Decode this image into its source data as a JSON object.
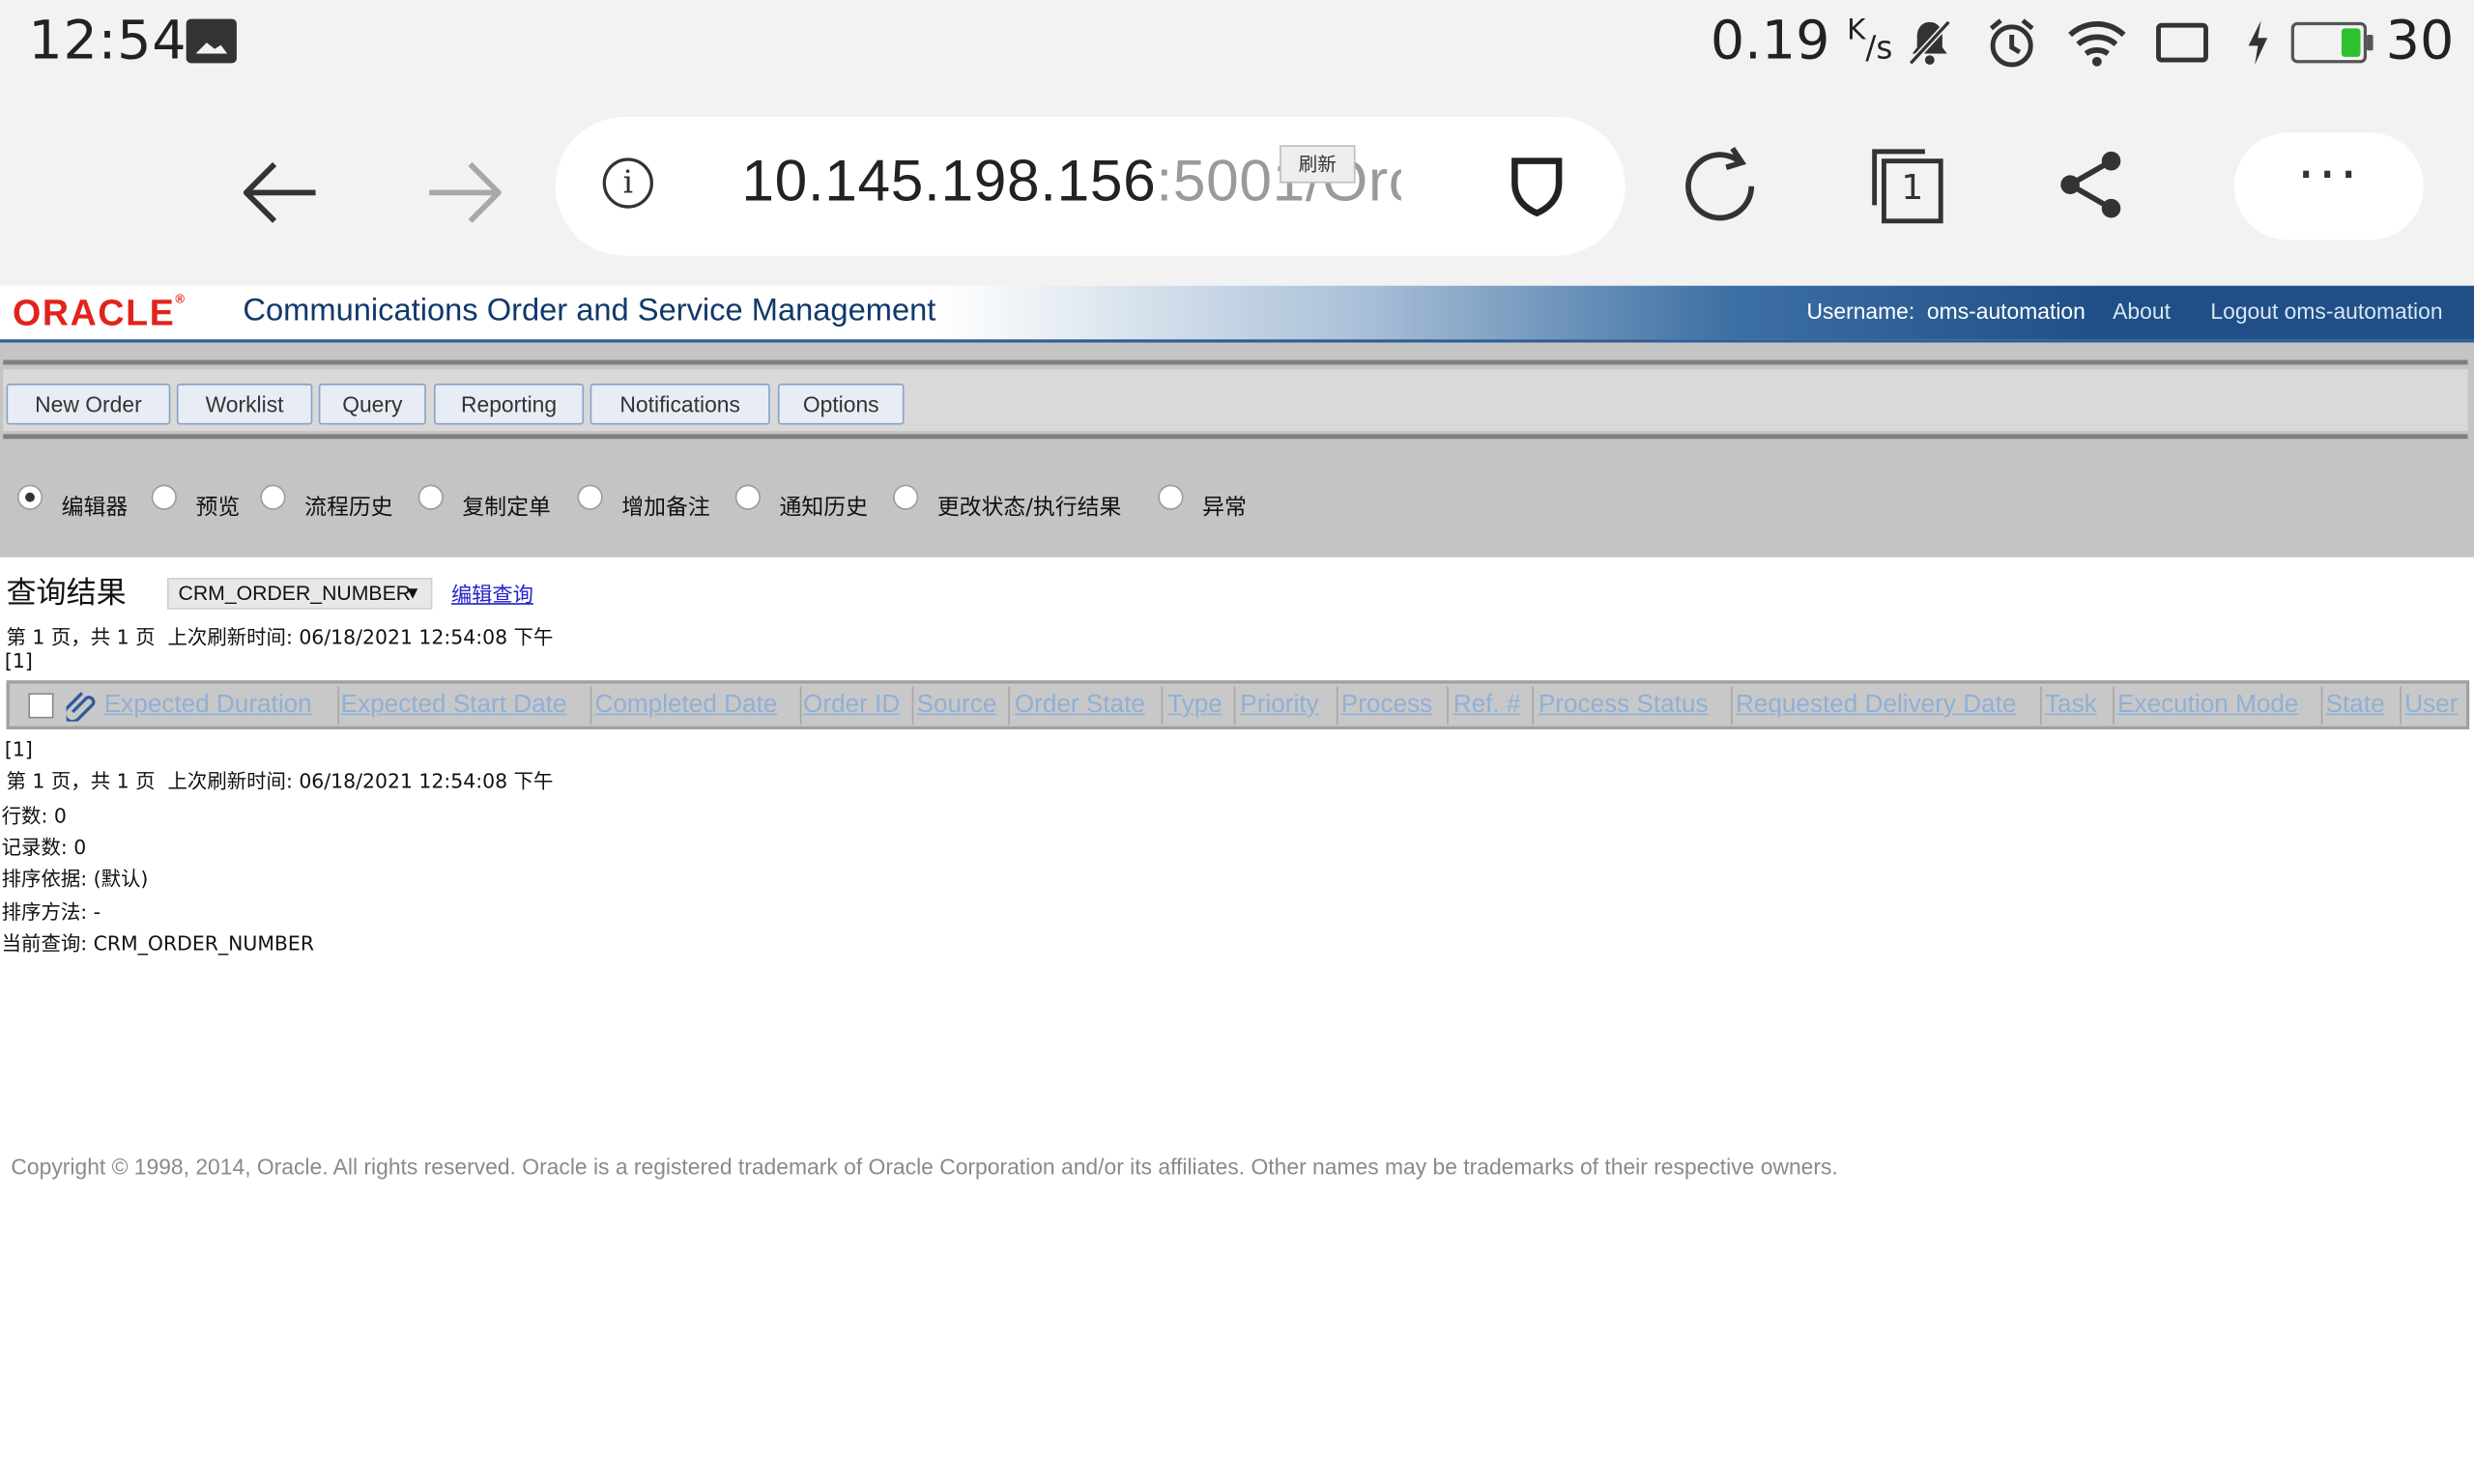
{
  "status_bar": {
    "time": "12:54",
    "net_speed": "0.19",
    "net_unit_top": "K",
    "net_unit_bottom": "/s",
    "battery": "30",
    "battery_level_percent": 30,
    "icons": [
      "gallery-icon",
      "bell-muted-icon",
      "alarm-icon",
      "wifi-icon",
      "screen-rotate-icon",
      "charging-icon",
      "battery-icon"
    ]
  },
  "browser": {
    "url_host": "10.145.198.156",
    "url_rest": ":5001/Orc",
    "tab_count": "1",
    "more": "···"
  },
  "header": {
    "logo": "ORACLE",
    "title": "Communications Order and Service Management",
    "username_label": "Username:",
    "username": "oms-automation",
    "about": "About",
    "logout": "Logout oms-automation"
  },
  "menu": {
    "items": [
      "New Order",
      "Worklist",
      "Query",
      "Reporting",
      "Notifications",
      "Options"
    ]
  },
  "view_options": {
    "items": [
      "编辑器",
      "预览",
      "流程历史",
      "复制定单",
      "增加备注",
      "通知历史",
      "更改状态/执行结果",
      "异常"
    ],
    "selected_index": 0,
    "refresh": "刷新"
  },
  "results": {
    "title": "查询结果",
    "query_name": "CRM_ORDER_NUMBER",
    "edit_query": "编辑查询",
    "page_info": "第 1 页，共 1 页",
    "refresh_time": "上次刷新时间: 06/18/2021 12:54:08 下午",
    "pager": "[1]",
    "columns": [
      "Expected Duration",
      "Expected Start Date",
      "Completed Date",
      "Order ID",
      "Source",
      "Order State",
      "Type",
      "Priority",
      "Process",
      "Ref. #",
      "Process Status",
      "Requested Delivery Date",
      "Task",
      "Execution Mode",
      "State",
      "User"
    ],
    "row_count": "行数: 0",
    "record_count": "记录数: 0",
    "sort_by": "排序依据: (默认)",
    "sort_method": "排序方法: -",
    "current_query": "当前查询: CRM_ORDER_NUMBER"
  },
  "footer": {
    "copyright": "Copyright © 1998, 2014, Oracle. All rights reserved. Oracle is a registered trademark of Oracle Corporation and/or its affiliates. Other names may be trademarks of their respective owners."
  },
  "colors": {
    "oracle_red": "#e2231a",
    "header_blue": "#1f4f86",
    "title_blue": "#10386b",
    "column_link": "#8fb0d6",
    "menu_gray": "#c4c4c4"
  }
}
